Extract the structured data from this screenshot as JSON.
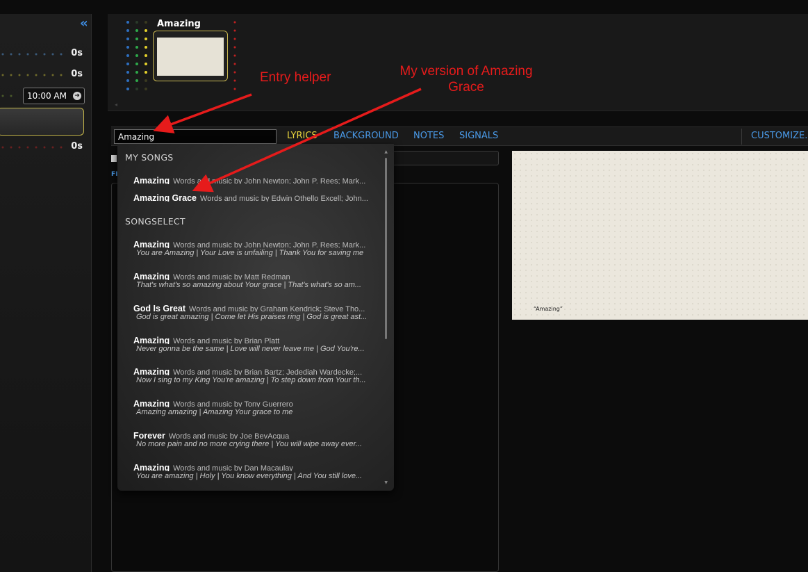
{
  "left_panel": {
    "collapse_icon": "«",
    "timers": [
      {
        "value": "0s"
      },
      {
        "value": "0s"
      },
      {
        "value": "0s"
      }
    ],
    "time_input": "10:00 AM",
    "go_icon": "➜"
  },
  "strip": {
    "slide_title": "Amazing",
    "scroll_icon": "◂"
  },
  "toolbar": {
    "search_value": "Amazing",
    "tabs": {
      "lyrics": "LYRICS",
      "background": "BACKGROUND",
      "notes": "NOTES",
      "signals": "SIGNALS",
      "customize": "CUSTOMIZE."
    }
  },
  "editor": {
    "label": "FI"
  },
  "preview": {
    "caption": "“Amazing”"
  },
  "dropdown": {
    "my_songs_header": "MY SONGS",
    "my_songs": [
      {
        "title": "Amazing",
        "credit": "Words and music by John Newton; John P. Rees; Mark..."
      },
      {
        "title": "Amazing Grace",
        "credit": "Words and music by Edwin Othello Excell; John..."
      }
    ],
    "songselect_header": "SONGSELECT",
    "songselect": [
      {
        "title": "Amazing",
        "credit": "Words and music by John Newton; John P. Rees; Mark...",
        "snippet": "You are Amazing | Your Love is unfailing | Thank You for saving me"
      },
      {
        "title": "Amazing",
        "credit": "Words and music by Matt Redman",
        "snippet": "That's what's so amazing about Your grace | That's what's so am..."
      },
      {
        "title": "God Is Great",
        "credit": "Words and music by Graham Kendrick; Steve Tho...",
        "snippet": "God is great amazing | Come let His praises ring | God is great ast..."
      },
      {
        "title": "Amazing",
        "credit": "Words and music by Brian Platt",
        "snippet": "Never gonna be the same | Love will never leave me | God You're..."
      },
      {
        "title": "Amazing",
        "credit": "Words and music by Brian Bartz; Jedediah Wardecke;...",
        "snippet": "Now I sing to my King You're amazing | To step down from Your th..."
      },
      {
        "title": "Amazing",
        "credit": "Words and music by Tony Guerrero",
        "snippet": "Amazing amazing | Amazing Your grace to me"
      },
      {
        "title": "Forever",
        "credit": "Words and music by Joe BevAcqua",
        "snippet": "No more pain and no more crying there | You will wipe away ever..."
      },
      {
        "title": "Amazing",
        "credit": "Words and music by Dan Macaulay",
        "snippet": "You are amazing | Holy | You know everything | And You still love..."
      }
    ]
  },
  "annotations": {
    "entry_helper": "Entry helper",
    "my_version": "My version of Amazing Grace"
  },
  "colors": {
    "accent_blue": "#4a9ae8",
    "active_tab": "#e9d53e",
    "highlight_border": "#c8b650",
    "annotation_red": "#e61b1b"
  }
}
